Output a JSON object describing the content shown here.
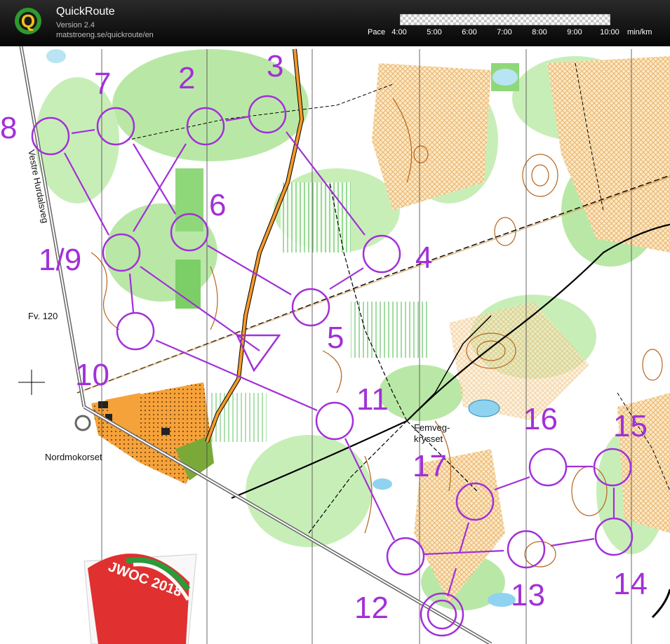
{
  "app": {
    "title": "QuickRoute",
    "version": "Version 2.4",
    "url": "matstroeng.se/quickroute/en",
    "logo_letter": "Q"
  },
  "pace": {
    "label": "Pace",
    "ticks": [
      "4:00",
      "5:00",
      "6:00",
      "7:00",
      "8:00",
      "9:00",
      "10:00"
    ],
    "unit": "min/km"
  },
  "map": {
    "place_names": {
      "road_west": "Vestre Hurdalsveg",
      "road_fv": "Fv. 120",
      "junction_sw": "Nordmokorset",
      "junction_center_1": "Femveg-",
      "junction_center_2": "krysset"
    },
    "controls": [
      "1/9",
      "2",
      "3",
      "4",
      "5",
      "6",
      "7",
      "8",
      "10",
      "11",
      "12",
      "13",
      "14",
      "15",
      "16",
      "17"
    ],
    "course_color": "#a230d8",
    "logo_text": "JWOC 2018"
  }
}
